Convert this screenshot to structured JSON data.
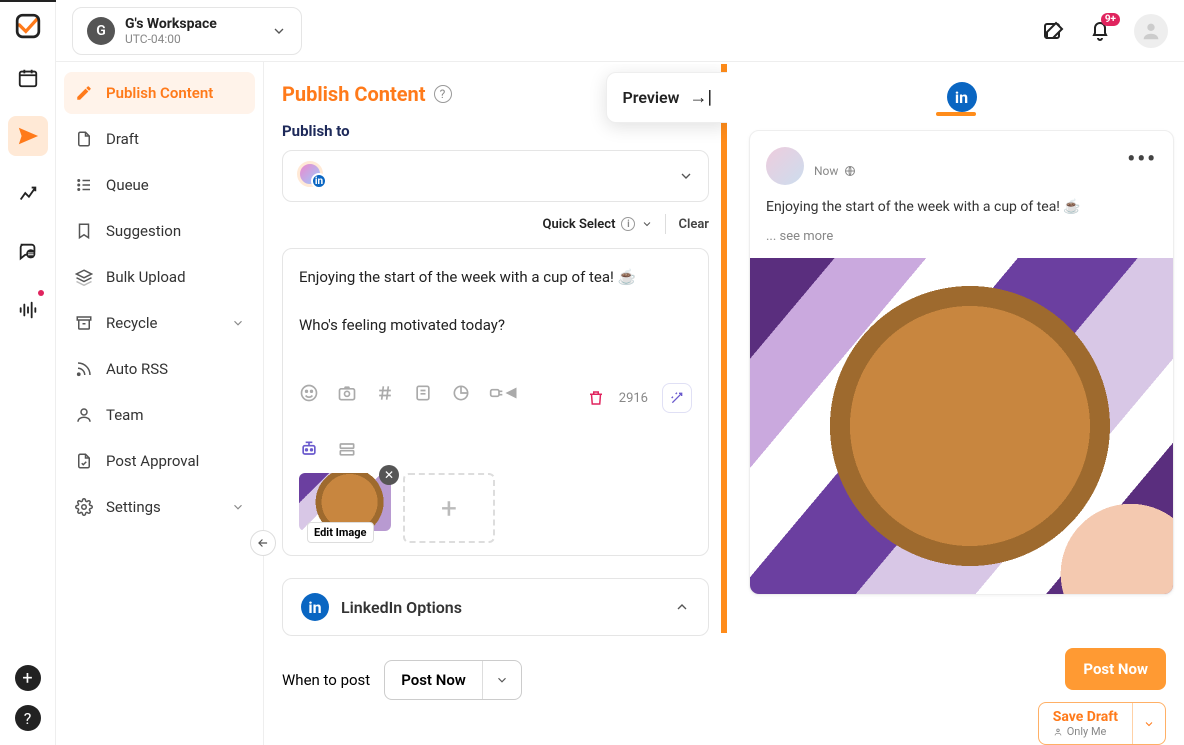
{
  "workspace": {
    "avatar_letter": "G",
    "title": "G's Workspace",
    "subtitle": "UTC-04:00"
  },
  "notifications_badge": "9+",
  "sidebar": {
    "items": [
      {
        "label": "Publish Content"
      },
      {
        "label": "Draft"
      },
      {
        "label": "Queue"
      },
      {
        "label": "Suggestion"
      },
      {
        "label": "Bulk Upload"
      },
      {
        "label": "Recycle"
      },
      {
        "label": "Auto RSS"
      },
      {
        "label": "Team"
      },
      {
        "label": "Post Approval"
      },
      {
        "label": "Settings"
      }
    ]
  },
  "editor": {
    "title": "Publish Content",
    "preview_label": "Preview",
    "publish_to_label": "Publish to",
    "quick_select": "Quick Select",
    "clear": "Clear",
    "compose_text": "Enjoying the start of the week with a cup of tea! ☕\n\nWho's feeling motivated today?",
    "char_count": "2916",
    "edit_image": "Edit Image",
    "linkedin_options": "LinkedIn Options",
    "when_to_post": "When to post",
    "when_value": "Post Now"
  },
  "preview_post": {
    "time": "Now",
    "text": "Enjoying the start of the week with a cup of tea! ☕",
    "see_more": "... see more"
  },
  "actions": {
    "post_now": "Post Now",
    "save_draft": "Save Draft",
    "only_me": "Only Me"
  }
}
